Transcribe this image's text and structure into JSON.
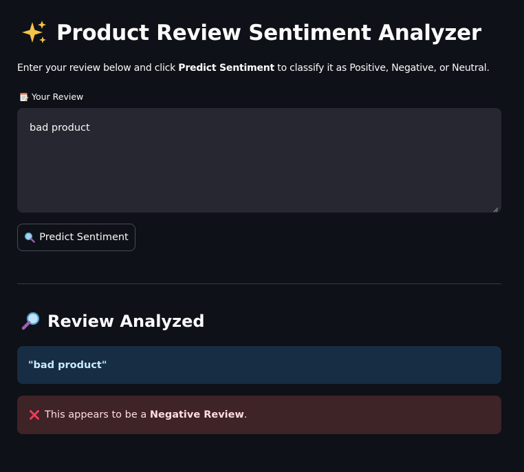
{
  "header": {
    "title": "Product Review Sentiment Analyzer",
    "title_icon": "sparkles-icon"
  },
  "intro": {
    "prefix": "Enter your review below and click ",
    "emphasis": "Predict Sentiment",
    "suffix": " to classify it as Positive, Negative, or Neutral."
  },
  "review_field": {
    "label": "Your Review",
    "label_icon": "memo-icon",
    "value": "bad product"
  },
  "predict_button": {
    "label": "Predict Sentiment",
    "icon": "magnifier-icon"
  },
  "results": {
    "heading": "Review Analyzed",
    "heading_icon": "magnifying-glass-icon",
    "quoted_review": "\"bad product\"",
    "message_prefix": "This appears to be a ",
    "message_emphasis": "Negative Review",
    "message_suffix": ".",
    "message_icon": "cross-mark-icon"
  },
  "colors": {
    "background": "#0e1117",
    "input_background": "#262730",
    "info_background": "#172d43",
    "info_text": "#c7ebff",
    "error_background": "#3e2327",
    "error_text": "#ffdede",
    "cross_mark": "#f23a5b"
  }
}
